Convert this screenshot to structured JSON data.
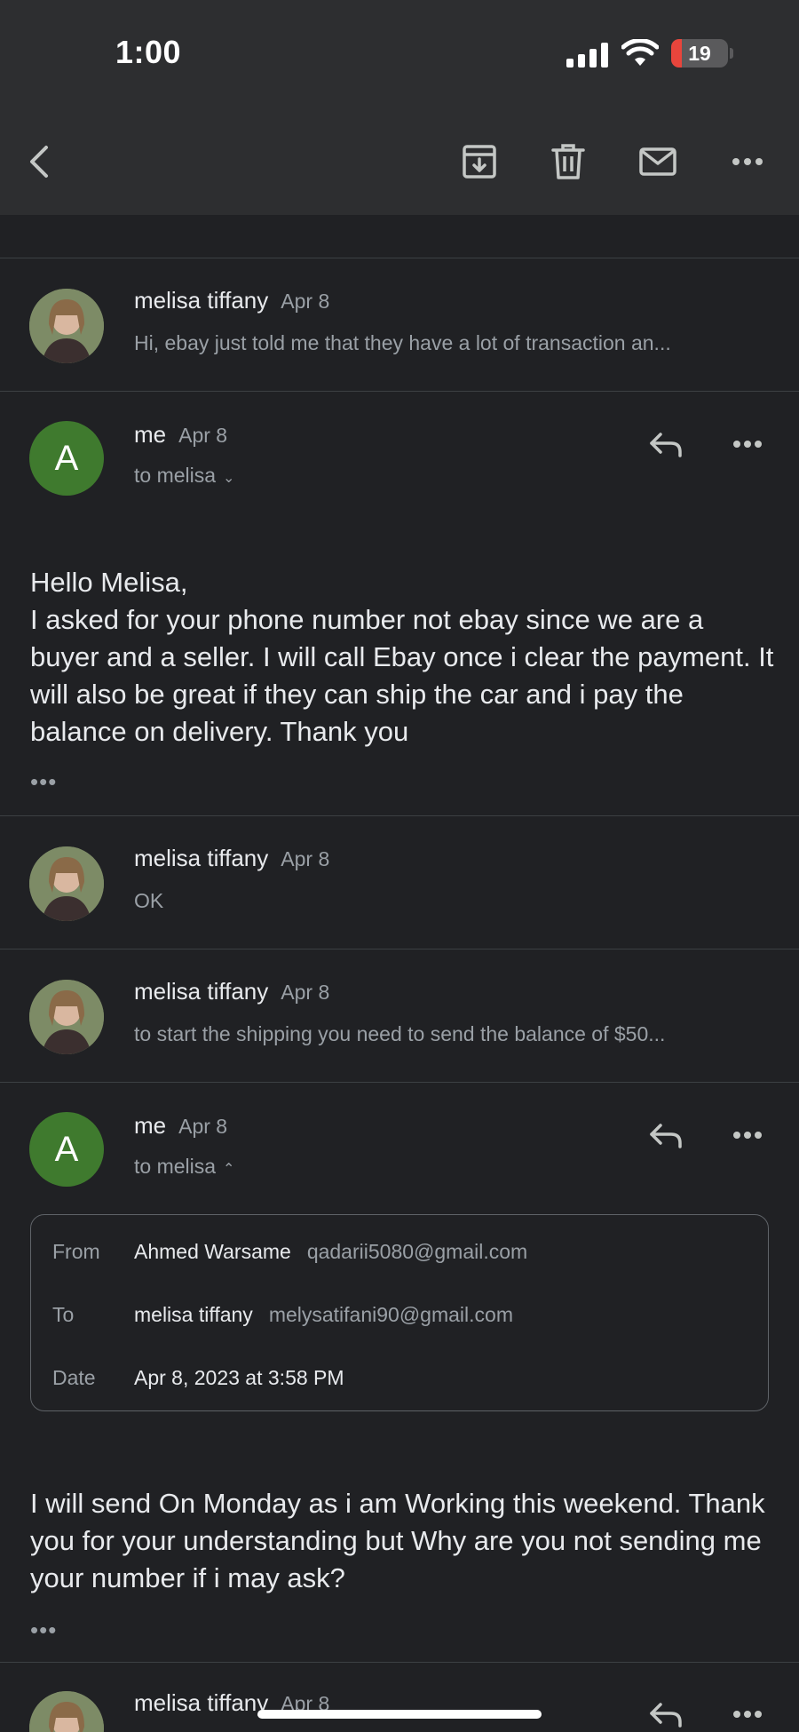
{
  "status_bar": {
    "time": "1:00",
    "battery_level": "19",
    "battery_fraction": 0.19
  },
  "toolbar": {
    "back_icon": "chevron-left-icon",
    "archive_icon": "archive-icon",
    "delete_icon": "trash-icon",
    "mark_unread_icon": "mail-icon",
    "more_icon": "more-horizontal-icon"
  },
  "messages": [
    {
      "sender": "melisa tiffany",
      "date": "Apr 8",
      "snippet": "Hi, ebay just told me that they have a lot of transaction an..."
    },
    {
      "sender": "me",
      "date": "Apr 8",
      "avatar_letter": "A",
      "recipient": "to melisa",
      "body": [
        "Hello Melisa,",
        "I asked for your phone number not ebay since we are a buyer and a seller. I will call Ebay once i clear the payment. It will also be great if they can ship the car and i pay the balance on delivery. Thank you"
      ],
      "ellipsis": "•••"
    },
    {
      "sender": "melisa tiffany",
      "date": "Apr 8",
      "snippet": "OK"
    },
    {
      "sender": "melisa tiffany",
      "date": "Apr 8",
      "snippet": "to start the shipping you need to send the balance of $50..."
    },
    {
      "sender": "me",
      "date": "Apr 8",
      "avatar_letter": "A",
      "recipient": "to melisa",
      "details": {
        "from_label": "From",
        "from_name": "Ahmed Warsame",
        "from_email": "qadarii5080@gmail.com",
        "to_label": "To",
        "to_name": "melisa tiffany",
        "to_email": "melysatifani90@gmail.com",
        "date_label": "Date",
        "date_value": "Apr 8, 2023 at 3:58 PM"
      },
      "body": [
        "I will send On Monday as i am Working this weekend. Thank you for your understanding but Why are you not sending me your number if i may ask?"
      ],
      "ellipsis": "•••"
    },
    {
      "sender": "melisa tiffany",
      "date": "Apr 8"
    }
  ],
  "colors": {
    "background": "#202124",
    "bar": "#2d2e30",
    "avatar_me": "#3f7a2e",
    "battery_low": "#e8453c"
  }
}
